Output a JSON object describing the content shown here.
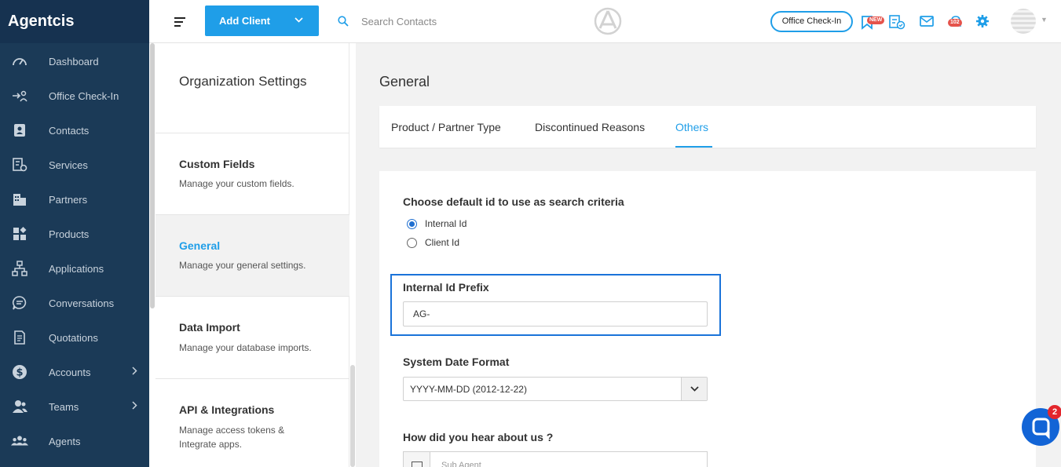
{
  "brand": "Agentcis",
  "sidebar": {
    "items": [
      {
        "label": "Dashboard",
        "icon": "speedometer-icon",
        "chevron": false
      },
      {
        "label": "Office Check-In",
        "icon": "check-in-icon",
        "chevron": false
      },
      {
        "label": "Contacts",
        "icon": "contact-card-icon",
        "chevron": false
      },
      {
        "label": "Services",
        "icon": "services-icon",
        "chevron": false
      },
      {
        "label": "Partners",
        "icon": "building-icon",
        "chevron": false
      },
      {
        "label": "Products",
        "icon": "products-grid-icon",
        "chevron": false
      },
      {
        "label": "Applications",
        "icon": "applications-flow-icon",
        "chevron": false
      },
      {
        "label": "Conversations",
        "icon": "chat-icon",
        "chevron": false
      },
      {
        "label": "Quotations",
        "icon": "document-icon",
        "chevron": false
      },
      {
        "label": "Accounts",
        "icon": "dollar-icon",
        "chevron": true
      },
      {
        "label": "Teams",
        "icon": "team-icon",
        "chevron": true
      },
      {
        "label": "Agents",
        "icon": "agents-icon",
        "chevron": false
      }
    ]
  },
  "topbar": {
    "add_client_label": "Add Client",
    "search_placeholder": "Search Contacts",
    "office_checkin_label": "Office Check-In",
    "new_badge": "NEW",
    "notification_count": "102",
    "accent_color": "#1f9ee8"
  },
  "settings_panel": {
    "title": "Organization Settings",
    "items": [
      {
        "title": "Custom Fields",
        "desc": "Manage your custom fields."
      },
      {
        "title": "General",
        "desc": "Manage your general settings."
      },
      {
        "title": "Data Import",
        "desc": "Manage your database imports."
      },
      {
        "title": "API & Integrations",
        "desc": "Manage access tokens & Integrate apps."
      }
    ]
  },
  "main": {
    "title": "General",
    "tabs": [
      {
        "label": "Product / Partner Type"
      },
      {
        "label": "Discontinued Reasons"
      },
      {
        "label": "Others"
      }
    ],
    "search_criteria": {
      "question": "Choose default id to use as search criteria",
      "options": [
        "Internal Id",
        "Client Id"
      ],
      "selected": "Internal Id"
    },
    "prefix": {
      "label": "Internal Id Prefix",
      "value": "AG-"
    },
    "date_format": {
      "label": "System Date Format",
      "value": "YYYY-MM-DD (2012-12-22)"
    },
    "hear": {
      "label": "How did you hear about us ?",
      "option": "Sub Agent"
    }
  },
  "chat": {
    "badge": "2"
  }
}
